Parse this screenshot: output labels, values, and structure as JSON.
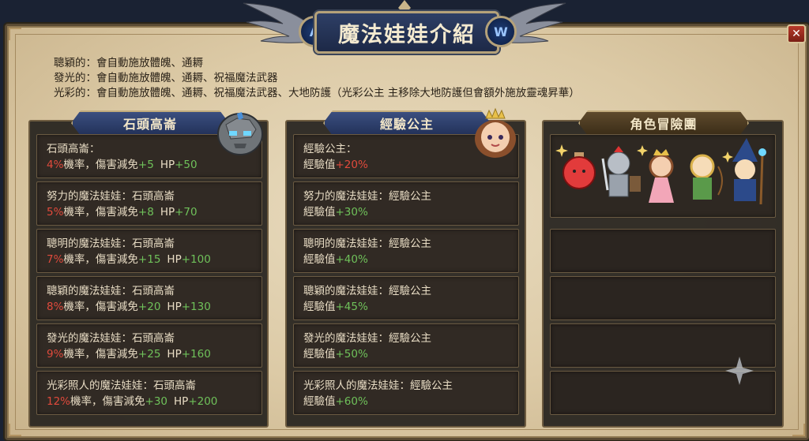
{
  "window": {
    "title": "魔法娃娃介紹",
    "close_label": "✕",
    "medal_left": "A",
    "medal_right": "W"
  },
  "info_lines": [
    "聰穎的：會自動施放體魄、通耨",
    "發光的：會自動施放體魄、通耨、祝福魔法武器",
    "光彩的：會自動施放體魄、通耨、祝福魔法武器、大地防護（光彩公主 主移除大地防護但會額外施放靈魂昇華）"
  ],
  "panels": {
    "stone": {
      "header": "石頭高崙",
      "slots": [
        {
          "name": "石頭高崙：",
          "rate": "4%",
          "rate_text": "機率，傷害減免",
          "dmg": "+5",
          "hp_label": "HP",
          "hp": "+50"
        },
        {
          "name": "努力的魔法娃娃：石頭高崙",
          "rate": "5%",
          "rate_text": "機率，傷害減免",
          "dmg": "+8",
          "hp_label": "HP",
          "hp": "+70"
        },
        {
          "name": "聰明的魔法娃娃：石頭高崙",
          "rate": "7%",
          "rate_text": "機率，傷害減免",
          "dmg": "+15",
          "hp_label": "HP",
          "hp": "+100"
        },
        {
          "name": "聰穎的魔法娃娃：石頭高崙",
          "rate": "8%",
          "rate_text": "機率，傷害減免",
          "dmg": "+20",
          "hp_label": "HP",
          "hp": "+130"
        },
        {
          "name": "發光的魔法娃娃：石頭高崙",
          "rate": "9%",
          "rate_text": "機率，傷害減免",
          "dmg": "+25",
          "hp_label": "HP",
          "hp": "+160"
        },
        {
          "name": "光彩照人的魔法娃娃：石頭高崙",
          "rate": "12%",
          "rate_text": "機率，傷害減免",
          "dmg": "+30",
          "hp_label": "HP",
          "hp": "+200"
        }
      ]
    },
    "exp": {
      "header": "經驗公主",
      "slots": [
        {
          "name": "經驗公主：",
          "label": "經驗值",
          "value": "+20%"
        },
        {
          "name": "努力的魔法娃娃：經驗公主",
          "label": "經驗值",
          "value": "+30%"
        },
        {
          "name": "聰明的魔法娃娃：經驗公主",
          "label": "經驗值",
          "value": "+40%"
        },
        {
          "name": "聰穎的魔法娃娃：經驗公主",
          "label": "經驗值",
          "value": "+45%"
        },
        {
          "name": "發光的魔法娃娃：經驗公主",
          "label": "經驗值",
          "value": "+50%"
        },
        {
          "name": "光彩照人的魔法娃娃：經驗公主",
          "label": "經驗值",
          "value": "+60%"
        }
      ]
    },
    "party": {
      "header": "角色冒險團"
    }
  },
  "colors": {
    "bad_value": "#e04a3c",
    "good_value": "#6fc15a",
    "header_blue": "#2e3f66",
    "parchment": "#e0d0ae"
  }
}
